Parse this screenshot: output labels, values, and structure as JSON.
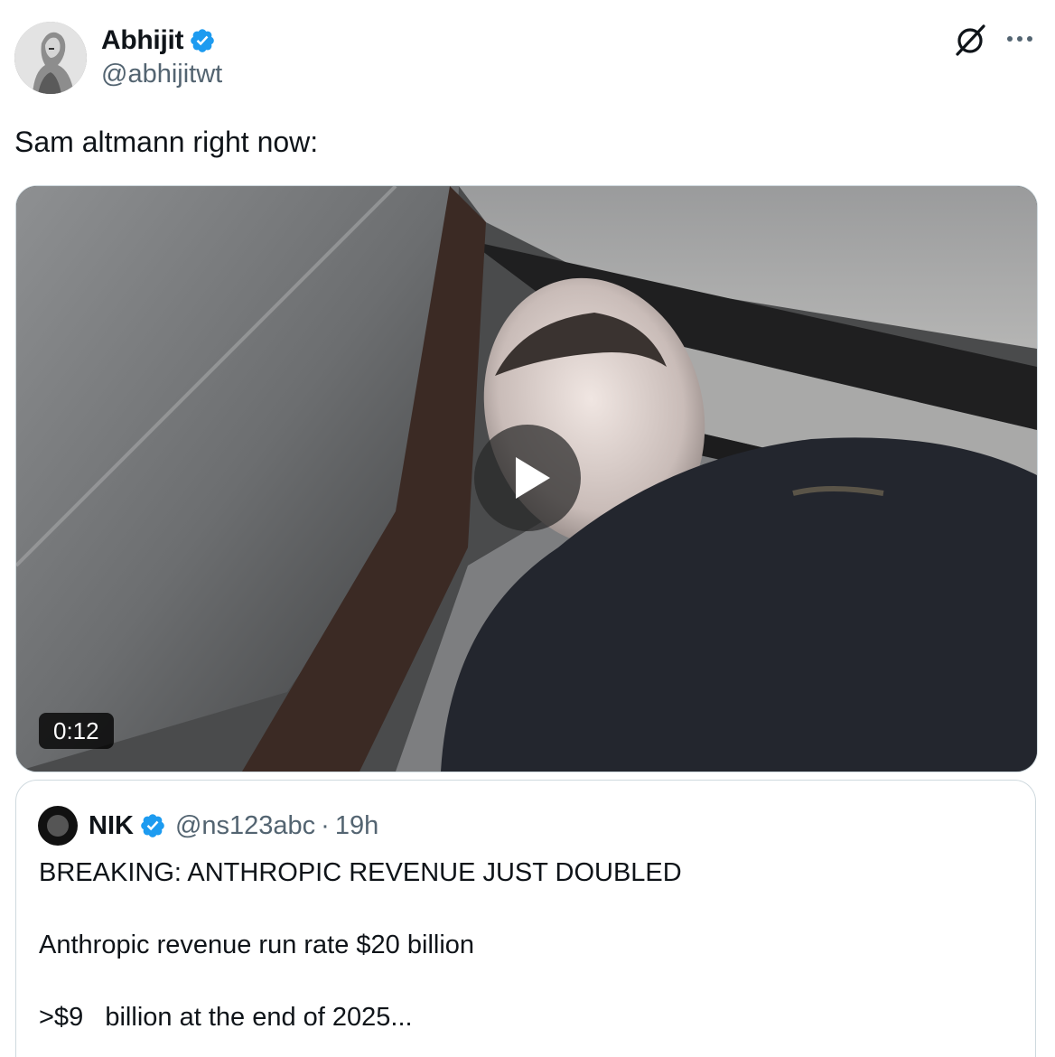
{
  "author": {
    "display_name": "Abhijit",
    "handle": "@abhijitwt",
    "verified": true,
    "avatar": "silver-robot-figure-avatar"
  },
  "header_icons": {
    "grok": "grok-slash-circle-icon",
    "more": "more-dots-icon"
  },
  "tweet": {
    "text": "Sam altmann right now:"
  },
  "video": {
    "duration": "0:12",
    "play_icon": "play-icon"
  },
  "quoted": {
    "display_name": "NIK",
    "handle": "@ns123abc",
    "separator": "·",
    "time": "19h",
    "verified": true,
    "lines": [
      "BREAKING: ANTHROPIC REVENUE JUST DOUBLED",
      "Anthropic revenue run rate $20 billion",
      ">$9   billion at the end of 2025..."
    ]
  },
  "colors": {
    "verified_blue": "#1d9bf0",
    "secondary_text": "#536471",
    "border": "#cfd9de"
  }
}
